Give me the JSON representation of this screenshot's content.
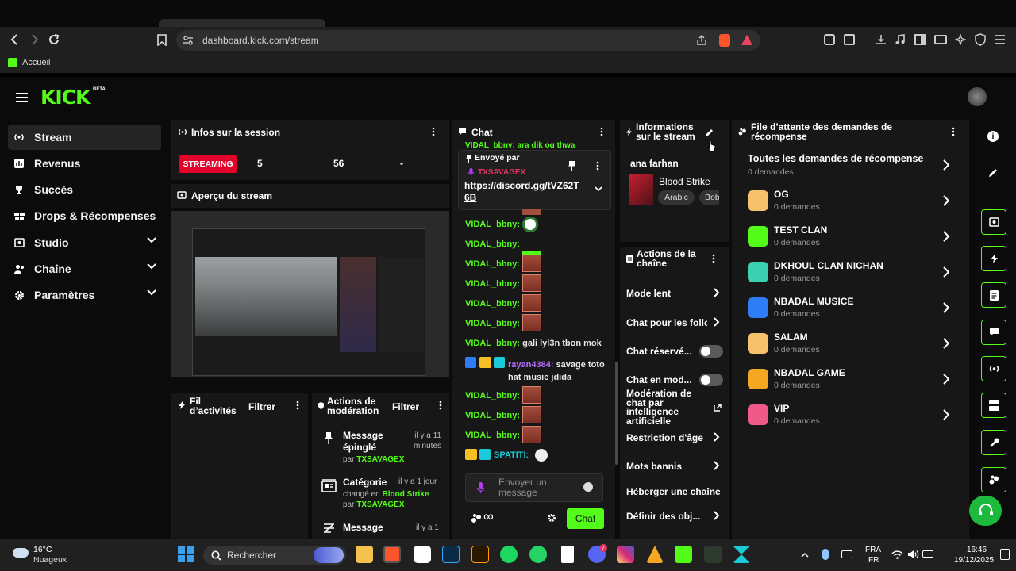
{
  "browser": {
    "url": "dashboard.kick.com/stream",
    "bookmark": "Accueil"
  },
  "brand": {
    "logo": "KICK",
    "badge": "BETA",
    "accent": "#53fc18"
  },
  "sidebar": {
    "items": [
      {
        "label": "Stream",
        "icon": "broadcast-icon",
        "active": true
      },
      {
        "label": "Revenus",
        "icon": "chart-icon"
      },
      {
        "label": "Succès",
        "icon": "trophy-icon"
      },
      {
        "label": "Drops & Récompenses",
        "icon": "gift-icon"
      },
      {
        "label": "Studio",
        "icon": "studio-icon",
        "expandable": true
      },
      {
        "label": "Chaîne",
        "icon": "users-icon",
        "expandable": true
      },
      {
        "label": "Paramètres",
        "icon": "gear-icon",
        "expandable": true
      }
    ]
  },
  "session": {
    "title": "Infos sur la session",
    "status": "STREAMING",
    "stat1": "5",
    "stat2": "56",
    "stat3": "-"
  },
  "preview": {
    "title": "Aperçu du stream"
  },
  "activity": {
    "title": "Fil d’activités",
    "filter": "Filtrer"
  },
  "moderation": {
    "title": "Actions de modération",
    "filter": "Filtrer",
    "items": [
      {
        "title": "Message épinglé",
        "time": "il y a 11 minutes",
        "by_prefix": "par",
        "by": "TXSAVAGEX"
      },
      {
        "title": "Catégorie",
        "time": "il y a 1 jour",
        "detail_prefix": "changé en",
        "detail": "Blood Strike",
        "by_prefix": "par",
        "by": "TXSAVAGEX"
      },
      {
        "title": "Message",
        "time": "il y a 1"
      }
    ]
  },
  "chat": {
    "title": "Chat",
    "top_partial": "VIDAL_bbny: ara dik og thwa",
    "pinned": {
      "label": "Envoyé par",
      "user": "TXSAVAGEX",
      "link": "https://discord.gg/tVZ62T6B"
    },
    "messages": [
      {
        "user": "VIDAL_bbny:",
        "text": ""
      },
      {
        "user": "VIDAL_bbny:",
        "text": ""
      },
      {
        "user": "VIDAL_bbny:",
        "text": ""
      },
      {
        "user": "VIDAL_bbny:",
        "text": ""
      },
      {
        "user": "VIDAL_bbny:",
        "text": ""
      },
      {
        "user": "VIDAL_bbny:",
        "text": ""
      },
      {
        "user": "VIDAL_bbny:",
        "text": "gali lyl3n tbon mok"
      },
      {
        "user": "rayan4384:",
        "text": "savage toto hat music jdida"
      },
      {
        "user": "VIDAL_bbny:",
        "text": ""
      },
      {
        "user": "VIDAL_bbny:",
        "text": ""
      },
      {
        "user": "VIDAL_bbny:",
        "text": ""
      },
      {
        "user": "SPATITI:",
        "text": ""
      }
    ],
    "input_placeholder": "Envoyer un message",
    "send_label": "Chat"
  },
  "stream_info": {
    "title": "Informations sur le stream",
    "stream_title": "ana farhan",
    "category": "Blood Strike",
    "tags": [
      "Arabic",
      "Bob"
    ]
  },
  "channel_actions": {
    "title": "Actions de la chaîne",
    "items": [
      {
        "label": "Mode lent",
        "kind": "chevron"
      },
      {
        "label": "Chat pour les follo",
        "kind": "chevron"
      },
      {
        "label": "Chat réservé...",
        "kind": "toggle"
      },
      {
        "label": "Chat en mod...",
        "kind": "toggle"
      },
      {
        "label": "Modération de chat par intelligence artificielle",
        "kind": "external"
      },
      {
        "label": "Restriction d'âge",
        "kind": "chevron"
      },
      {
        "label": "Mots bannis",
        "kind": "chevron"
      },
      {
        "label": "Héberger une chaîne",
        "kind": "none"
      },
      {
        "label": "Définir des obj...",
        "kind": "chevron"
      }
    ]
  },
  "reward_queue": {
    "title": "File d’attente des demandes de récompense",
    "all": {
      "name": "Toutes les demandes de récompense",
      "count": "0 demandes"
    },
    "items": [
      {
        "name": "OG",
        "count": "0 demandes",
        "color": "#f5c26b"
      },
      {
        "name": "TEST CLAN",
        "count": "0 demandes",
        "color": "#53fc18"
      },
      {
        "name": "DKHOUL CLAN NICHAN",
        "count": "0 demandes",
        "color": "#3ad0b0"
      },
      {
        "name": "NBADAL MUSICE",
        "count": "0 demandes",
        "color": "#2f7df6"
      },
      {
        "name": "SALAM",
        "count": "0 demandes",
        "color": "#f5c26b"
      },
      {
        "name": "NBADAL GAME",
        "count": "0 demandes",
        "color": "#f5a623"
      },
      {
        "name": "VIP",
        "count": "0 demandes",
        "color": "#f05a8a"
      }
    ]
  },
  "taskbar": {
    "weather_temp": "16°C",
    "weather_desc": "Nuageux",
    "search": "Rechercher",
    "lang1": "FRA",
    "lang2": "FR",
    "time": "16:46",
    "date": "19/12/2025",
    "badge": "7"
  }
}
